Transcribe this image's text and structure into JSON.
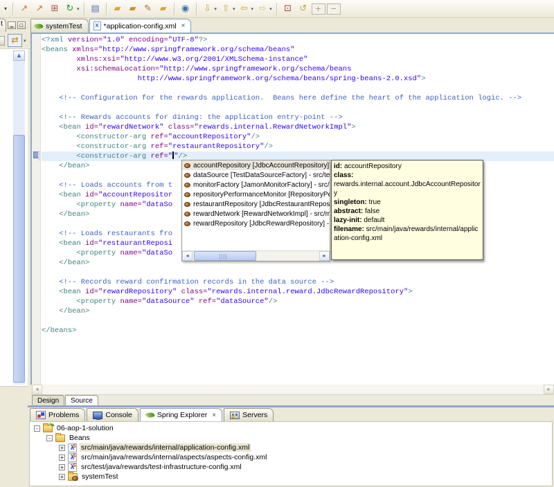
{
  "colors": {
    "chrome_bg": "#ece9d8",
    "editor_bg": "#ffffff",
    "active_border": "#8fa7c8",
    "current_line": "#e3effb",
    "tooltip_bg": "#fffee1",
    "selection": "#e9e7dd",
    "xml_tag": "#3f7f7f",
    "xml_attr": "#7f007f",
    "xml_value": "#2a00ff",
    "xml_comment": "#3f5fbf"
  },
  "toolbar": {
    "items": [
      {
        "name": "toolbar-overflow-caret",
        "glyph": "▾",
        "color": "#444",
        "caretonly": true
      },
      {
        "sep": true
      },
      {
        "name": "new-wizard-icon",
        "glyph": "↗",
        "color": "#c87828"
      },
      {
        "name": "new-test-wizard-icon",
        "glyph": "↗",
        "color": "#c87828"
      },
      {
        "name": "new-package-icon",
        "glyph": "⊞",
        "color": "#a3524b"
      },
      {
        "name": "refresh-icon",
        "glyph": "↻",
        "color": "#1f9d1f",
        "caret": true
      },
      {
        "sep": true
      },
      {
        "name": "report-icon",
        "glyph": "▤",
        "color": "#5577bb"
      },
      {
        "sep": true
      },
      {
        "name": "open-type-icon",
        "glyph": "▰",
        "color": "#d8a23a"
      },
      {
        "name": "open-resource-icon",
        "glyph": "▰",
        "color": "#c89032"
      },
      {
        "name": "annotate-icon",
        "glyph": "✎",
        "color": "#b06a32"
      },
      {
        "name": "open-folder-icon",
        "glyph": "▰",
        "color": "#d8a23a"
      },
      {
        "sep": true
      },
      {
        "name": "web-browser-icon",
        "glyph": "◉",
        "color": "#3a6ea5"
      },
      {
        "sep": true
      },
      {
        "name": "import-icon",
        "glyph": "⇩",
        "color": "#caa53d",
        "caret": true
      },
      {
        "name": "export-icon",
        "glyph": "⇧",
        "color": "#caa53d",
        "caret": true
      },
      {
        "name": "back-icon",
        "glyph": "⇦",
        "color": "#d8a020",
        "caret": true
      },
      {
        "name": "forward-icon",
        "glyph": "⇨",
        "color": "#e0c070",
        "caret": true
      },
      {
        "sep": true
      },
      {
        "name": "last-edit-location-icon",
        "glyph": "⊡",
        "color": "#a04030"
      },
      {
        "name": "refresh-config-icon",
        "glyph": "↺",
        "color": "#caa53d"
      },
      {
        "name": "expand-all-button",
        "glyph": "+",
        "color": "#9a968a",
        "boxed": true
      },
      {
        "name": "collapse-all-button",
        "glyph": "−",
        "color": "#9a968a",
        "boxed": true
      }
    ]
  },
  "left_panel": {
    "tab_label": "t",
    "minimize_glyph": "▁",
    "maximize_glyph": "□",
    "link_glyph": "⇄",
    "menu_caret": "▾",
    "scroll_up_glyph": "▲"
  },
  "editor": {
    "tabs": [
      {
        "label": "systemTest",
        "icon": "spring-leaf-icon",
        "active": false
      },
      {
        "label": "*application-config.xml",
        "icon": "xml-file-icon",
        "active": true,
        "close_glyph": "×"
      }
    ],
    "page_tabs": [
      {
        "label": "Design",
        "active": false
      },
      {
        "label": "Source",
        "active": true
      }
    ],
    "lines": [
      {
        "seg": [
          [
            "t",
            "<?xml "
          ],
          [
            "a",
            "version="
          ],
          [
            "v",
            "\"1.0\""
          ],
          [
            "a",
            " encoding="
          ],
          [
            "v",
            "\"UTF-8\""
          ],
          [
            "t",
            "?>"
          ]
        ]
      },
      {
        "seg": [
          [
            "t",
            "<beans "
          ],
          [
            "a",
            "xmlns="
          ],
          [
            "v",
            "\"http://www.springframework.org/schema/beans\""
          ]
        ]
      },
      {
        "seg": [
          [
            "p",
            "        "
          ],
          [
            "a",
            "xmlns:xsi="
          ],
          [
            "v",
            "\"http://www.w3.org/2001/XMLSchema-instance\""
          ]
        ]
      },
      {
        "seg": [
          [
            "p",
            "        "
          ],
          [
            "a",
            "xsi:schemaLocation="
          ],
          [
            "v",
            "\"http://www.springframework.org/schema/beans"
          ]
        ]
      },
      {
        "seg": [
          [
            "p",
            "                      "
          ],
          [
            "v",
            "http://www.springframework.org/schema/beans/spring-beans-2.0.xsd\""
          ],
          [
            "t",
            ">"
          ]
        ]
      },
      {
        "seg": []
      },
      {
        "seg": [
          [
            "p",
            "    "
          ],
          [
            "c",
            "<!-- Configuration for the rewards application.  Beans here define the heart of the application logic. -->"
          ]
        ]
      },
      {
        "seg": []
      },
      {
        "seg": [
          [
            "p",
            "    "
          ],
          [
            "c",
            "<!-- Rewards accounts for dining: the application entry-point -->"
          ]
        ]
      },
      {
        "seg": [
          [
            "p",
            "    "
          ],
          [
            "t",
            "<bean "
          ],
          [
            "a",
            "id="
          ],
          [
            "v",
            "\"rewardNetwork\""
          ],
          [
            "a",
            " class="
          ],
          [
            "v",
            "\"rewards.internal.RewardNetworkImpl\""
          ],
          [
            "t",
            ">"
          ]
        ]
      },
      {
        "seg": [
          [
            "p",
            "        "
          ],
          [
            "t",
            "<constructor-arg "
          ],
          [
            "a",
            "ref="
          ],
          [
            "v",
            "\"accountRepository\""
          ],
          [
            "t",
            "/>"
          ]
        ]
      },
      {
        "seg": [
          [
            "p",
            "        "
          ],
          [
            "t",
            "<constructor-arg "
          ],
          [
            "a",
            "ref="
          ],
          [
            "v",
            "\"restaurantRepository\""
          ],
          [
            "t",
            "/>"
          ]
        ]
      },
      {
        "cur": true,
        "seg": [
          [
            "p",
            "        "
          ],
          [
            "t",
            "<constructor-arg "
          ],
          [
            "a",
            "ref="
          ],
          [
            "v",
            "\""
          ],
          [
            "k",
            ""
          ],
          [
            "v",
            "\""
          ],
          [
            "t",
            "/>"
          ]
        ]
      },
      {
        "seg": [
          [
            "p",
            "    "
          ],
          [
            "t",
            "</bean>"
          ]
        ]
      },
      {
        "seg": []
      },
      {
        "seg": [
          [
            "p",
            "    "
          ],
          [
            "c",
            "<!-- Loads accounts from t"
          ]
        ]
      },
      {
        "seg": [
          [
            "p",
            "    "
          ],
          [
            "t",
            "<bean "
          ],
          [
            "a",
            "id="
          ],
          [
            "v",
            "\"accountRepositor"
          ]
        ]
      },
      {
        "seg": [
          [
            "p",
            "        "
          ],
          [
            "t",
            "<property "
          ],
          [
            "a",
            "name="
          ],
          [
            "v",
            "\"dataSo"
          ]
        ]
      },
      {
        "seg": [
          [
            "p",
            "    "
          ],
          [
            "t",
            "</bean>"
          ]
        ]
      },
      {
        "seg": []
      },
      {
        "seg": [
          [
            "p",
            "    "
          ],
          [
            "c",
            "<!-- Loads restaurants fro"
          ]
        ]
      },
      {
        "seg": [
          [
            "p",
            "    "
          ],
          [
            "t",
            "<bean "
          ],
          [
            "a",
            "id="
          ],
          [
            "v",
            "\"restaurantReposi"
          ]
        ]
      },
      {
        "seg": [
          [
            "p",
            "        "
          ],
          [
            "t",
            "<property "
          ],
          [
            "a",
            "name="
          ],
          [
            "v",
            "\"dataSo"
          ]
        ]
      },
      {
        "seg": [
          [
            "p",
            "    "
          ],
          [
            "t",
            "</bean>"
          ]
        ]
      },
      {
        "seg": []
      },
      {
        "seg": [
          [
            "p",
            "    "
          ],
          [
            "c",
            "<!-- Records reward confirmation records in the data source -->"
          ]
        ]
      },
      {
        "seg": [
          [
            "p",
            "    "
          ],
          [
            "t",
            "<bean "
          ],
          [
            "a",
            "id="
          ],
          [
            "v",
            "\"rewardRepository\""
          ],
          [
            "a",
            " class="
          ],
          [
            "v",
            "\"rewards.internal.reward.JdbcRewardRepository\""
          ],
          [
            "t",
            ">"
          ]
        ]
      },
      {
        "seg": [
          [
            "p",
            "        "
          ],
          [
            "t",
            "<property "
          ],
          [
            "a",
            "name="
          ],
          [
            "v",
            "\"dataSource\""
          ],
          [
            "a",
            " ref="
          ],
          [
            "v",
            "\"dataSource\""
          ],
          [
            "t",
            "/>"
          ]
        ]
      },
      {
        "seg": [
          [
            "p",
            "    "
          ],
          [
            "t",
            "</bean>"
          ]
        ]
      },
      {
        "seg": []
      },
      {
        "seg": [
          [
            "t",
            "</beans>"
          ]
        ]
      }
    ]
  },
  "completion": {
    "items": [
      {
        "label": "accountRepository [JdbcAccountRepository] - src",
        "selected": true
      },
      {
        "label": "dataSource [TestDataSourceFactory] - src/test/ja"
      },
      {
        "label": "monitorFactory [JamonMonitorFactory] - src/main"
      },
      {
        "label": "repositoryPerformanceMonitor [RepositoryPerform"
      },
      {
        "label": "restaurantRepository [JdbcRestaurantRepository"
      },
      {
        "label": "rewardNetwork [RewardNetworkImpl] - src/main/j"
      },
      {
        "label": "rewardRepository [JdbcRewardRepository] - src/m"
      }
    ]
  },
  "tooltip": {
    "rows": [
      [
        [
          "b",
          "id:"
        ],
        [
          "n",
          " accountRepository"
        ]
      ],
      [
        [
          "b",
          "class:"
        ]
      ],
      [
        [
          "n",
          " rewards.internal.account.JdbcAccountRepository"
        ]
      ],
      [
        [
          "b",
          "singleton:"
        ],
        [
          "n",
          " true"
        ]
      ],
      [
        [
          "b",
          "abstract:"
        ],
        [
          "n",
          " false"
        ]
      ],
      [
        [
          "b",
          "lazy-init:"
        ],
        [
          "n",
          " default"
        ]
      ],
      [
        [
          "b",
          "filename:"
        ],
        [
          "n",
          " src/main/java/rewards/internal/application-config.xml"
        ]
      ]
    ]
  },
  "bottom_panel": {
    "tabs": [
      {
        "label": "Problems",
        "icon": "problems-icon",
        "active": false
      },
      {
        "label": "Console",
        "icon": "console-icon",
        "active": false
      },
      {
        "label": "Spring Explorer",
        "icon": "spring-leaf-icon",
        "active": true,
        "close_glyph": "×"
      },
      {
        "label": "Servers",
        "icon": "servers-icon",
        "active": false
      }
    ],
    "tree": [
      {
        "depth": 0,
        "expander": "-",
        "icon": "spring-project-icon",
        "label": "06-aop-1-solution"
      },
      {
        "depth": 1,
        "expander": "-",
        "icon": "beans-folder-icon",
        "label": "Beans"
      },
      {
        "depth": 2,
        "expander": "+",
        "icon": "spring-config-icon",
        "label": "src/main/java/rewards/internal/application-config.xml",
        "selected": true
      },
      {
        "depth": 2,
        "expander": "+",
        "icon": "spring-config-icon",
        "label": "src/main/java/rewards/internal/aspects/aspects-config.xml"
      },
      {
        "depth": 2,
        "expander": "+",
        "icon": "spring-config-icon",
        "label": "src/test/java/rewards/test-infrastructure-config.xml"
      },
      {
        "depth": 2,
        "expander": "+",
        "icon": "bean-folder-icon",
        "label": "systemTest"
      }
    ]
  }
}
